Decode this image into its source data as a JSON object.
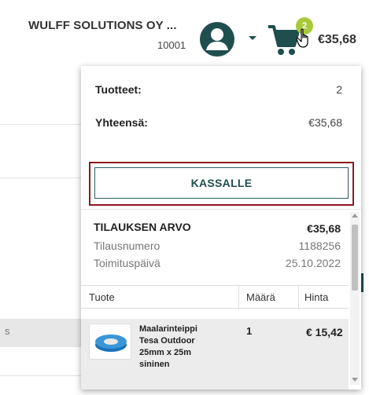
{
  "header": {
    "company_name": "WULFF SOLUTIONS OY ...",
    "customer_number": "10001",
    "cart_count": "2",
    "cart_total": "€35,68"
  },
  "background": {
    "side_letter": "s"
  },
  "cart_dropdown": {
    "products_label": "Tuotteet:",
    "products_count": "2",
    "total_label": "Yhteensä:",
    "total_value": "€35,68",
    "checkout_label": "KASSALLE"
  },
  "order": {
    "title": "TILAUKSEN ARVO",
    "value": "€35,68",
    "number_label": "Tilausnumero",
    "number_value": "1188256",
    "delivery_label": "Toimituspäivä",
    "delivery_value": "25.10.2022"
  },
  "table": {
    "columns": [
      "Tuote",
      "Määrä",
      "Hinta"
    ],
    "rows": [
      {
        "product": "Maalarinteippi Tesa Outdoor 25mm x 25m sininen",
        "quantity": "1",
        "price": "€ 15,42"
      }
    ]
  },
  "colors": {
    "brand": "#1f4e4e",
    "badge": "#a8c93a",
    "highlight": "#8b1a1f"
  },
  "icons": [
    "user-avatar-icon",
    "chevron-down-icon",
    "shopping-cart-icon",
    "hand-pointer-icon",
    "tape-product-icon"
  ]
}
